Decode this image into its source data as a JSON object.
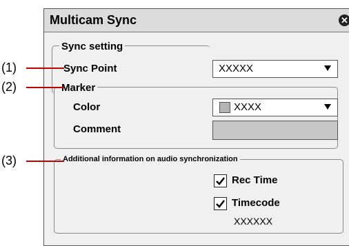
{
  "dialog": {
    "title": "Multicam Sync",
    "close_glyph": "✕"
  },
  "sync_setting": {
    "group_label": "Sync setting",
    "sync_point_label": "Sync Point",
    "sync_point_value": "XXXXX"
  },
  "marker": {
    "group_label": "Marker",
    "color_label": "Color",
    "color_value": "XXXX",
    "comment_label": "Comment",
    "comment_value": ""
  },
  "audio": {
    "group_label": "Additional information on audio synchronization",
    "rec_time_label": "Rec Time",
    "rec_time_checked": true,
    "timecode_label": "Timecode",
    "timecode_checked": true,
    "timecode_value": "XXXXXX"
  },
  "callouts": {
    "c1": "(1)",
    "c2": "(2)",
    "c3": "(3)"
  },
  "colors": {
    "leader_line": "#c00000",
    "dialog_bg": "#f0f0f0"
  }
}
